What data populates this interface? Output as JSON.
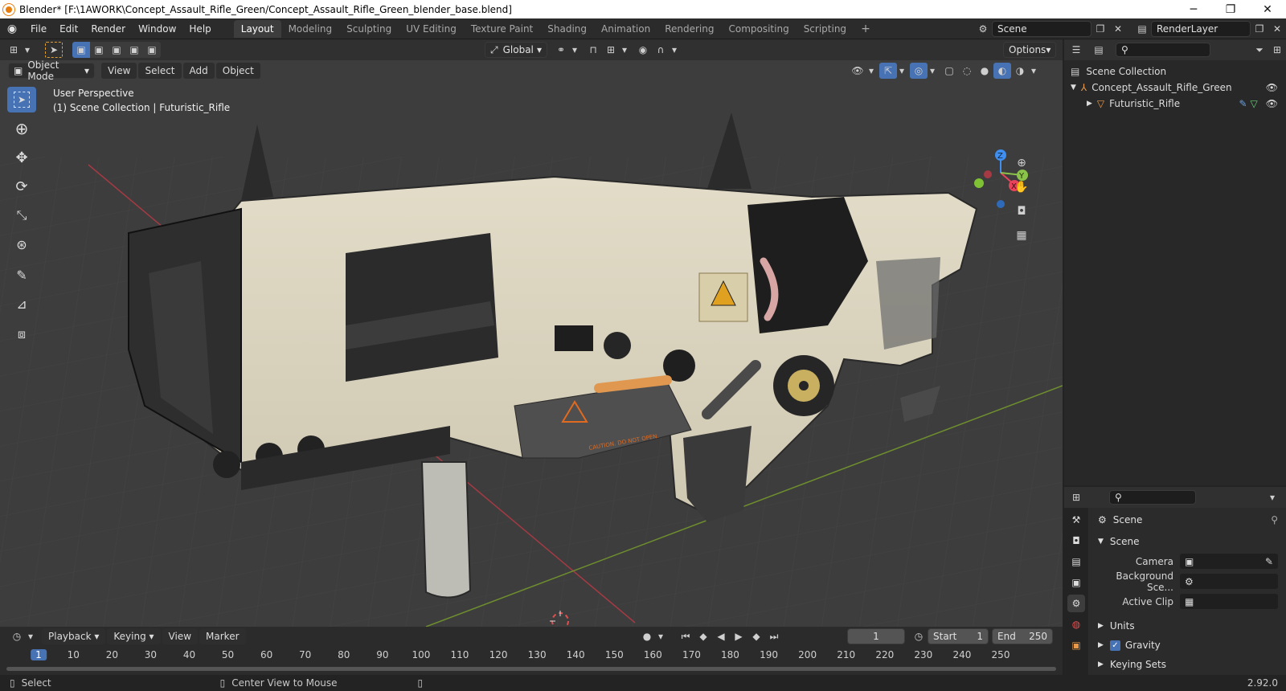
{
  "window": {
    "title": "Blender* [F:\\1AWORK\\Concept_Assault_Rifle_Green/Concept_Assault_Rifle_Green_blender_base.blend]",
    "minimize": "─",
    "restore": "❐",
    "close": "✕"
  },
  "menus": [
    "File",
    "Edit",
    "Render",
    "Window",
    "Help"
  ],
  "workspaces": [
    "Layout",
    "Modeling",
    "Sculpting",
    "UV Editing",
    "Texture Paint",
    "Shading",
    "Animation",
    "Rendering",
    "Compositing",
    "Scripting"
  ],
  "active_workspace": "Layout",
  "add_workspace": "+",
  "scene_name": "Scene",
  "view_layer": "RenderLayer",
  "tool_header": {
    "orientation": "Global",
    "options": "Options"
  },
  "viewport": {
    "mode": "Object Mode",
    "menu": [
      "View",
      "Select",
      "Add",
      "Object"
    ],
    "overlay_line1": "User Perspective",
    "overlay_line2": "(1) Scene Collection | Futuristic_Rifle",
    "gizmo": {
      "x": "X",
      "y": "Y",
      "z": "Z"
    },
    "decal_text": "CAUTION. DO NOT OPEN."
  },
  "outliner": {
    "root": "Scene Collection",
    "collection": "Concept_Assault_Rifle_Green",
    "object": "Futuristic_Rifle"
  },
  "properties": {
    "context": "Scene",
    "section": "Scene",
    "rows": [
      {
        "label": "Camera",
        "value": ""
      },
      {
        "label": "Background Sce...",
        "value": ""
      },
      {
        "label": "Active Clip",
        "value": ""
      }
    ],
    "subsections": [
      {
        "label": "Units",
        "checkbox": false
      },
      {
        "label": "Gravity",
        "checkbox": true,
        "checked": true
      },
      {
        "label": "Keying Sets",
        "checkbox": false
      }
    ]
  },
  "timeline": {
    "menu": [
      "Playback",
      "Keying",
      "View",
      "Marker"
    ],
    "current_frame": "1",
    "start_label": "Start",
    "start": "1",
    "end_label": "End",
    "end": "250",
    "ruler": [
      "1",
      "10",
      "20",
      "30",
      "40",
      "50",
      "60",
      "70",
      "80",
      "90",
      "100",
      "110",
      "120",
      "130",
      "140",
      "150",
      "160",
      "170",
      "180",
      "190",
      "200",
      "210",
      "220",
      "230",
      "240",
      "250"
    ]
  },
  "status": {
    "select": "Select",
    "center": "Center View to Mouse",
    "version": "2.92.0"
  },
  "colors": {
    "accent": "#4772b3",
    "x_axis": "#e8435a",
    "y_axis": "#8bc34a",
    "z_axis": "#3e8ff0"
  }
}
